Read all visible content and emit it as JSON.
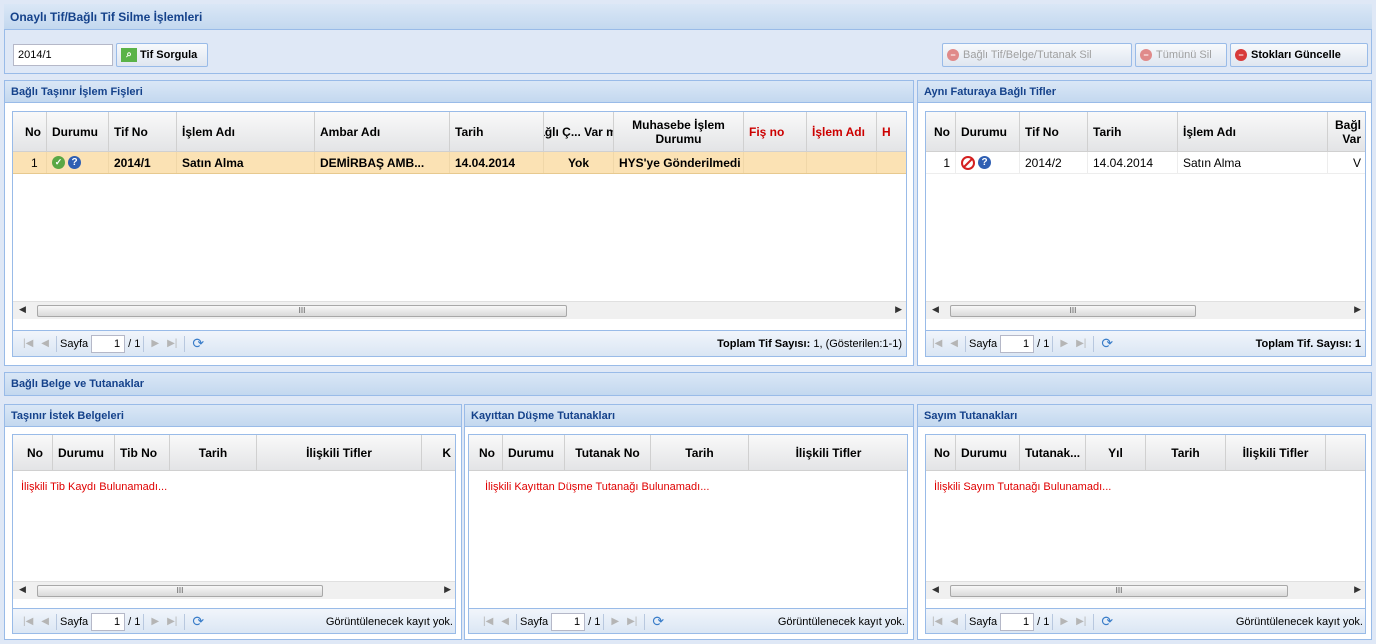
{
  "window_title": "Onaylı Tif/Bağlı Tif Silme İşlemleri",
  "toolbar": {
    "tif_input_value": "2014/1",
    "query_button": "Tif Sorgula",
    "delete_linked_button": "Bağlı Tif/Belge/Tutanak Sil",
    "delete_all_button": "Tümünü Sil",
    "update_stock_button": "Stokları Güncelle"
  },
  "fisler": {
    "title": "Bağlı Taşınır İşlem Fişleri",
    "columns": [
      "No",
      "Durumu",
      "Tif No",
      "İşlem Adı",
      "Ambar Adı",
      "Tarih",
      "Bağlı Ç... Var mı?",
      "Muhasebe İşlem Durumu",
      "Fiş no",
      "İşlem Adı",
      "H"
    ],
    "rows": [
      {
        "no": "1",
        "tif_no": "2014/1",
        "islem_adi": "Satın Alma",
        "ambar_adi": "DEMİRBAŞ AMB...",
        "tarih": "14.04.2014",
        "bagli": "Yok",
        "muhasebe": "HYS'ye Gönderilmedi"
      }
    ],
    "pager": {
      "page_label": "Sayfa",
      "page_value": "1",
      "page_total": "/ 1",
      "summary_label": "Toplam Tif Sayısı:",
      "summary_value": "1, (Gösterilen:1-1)"
    }
  },
  "ayni_fatura": {
    "title": "Aynı Faturaya Bağlı Tifler",
    "columns": [
      "No",
      "Durumu",
      "Tif No",
      "Tarih",
      "İşlem Adı",
      "Bağl Var"
    ],
    "rows": [
      {
        "no": "1",
        "tif_no": "2014/2",
        "tarih": "14.04.2014",
        "islem_adi": "Satın Alma",
        "bagli": "V"
      }
    ],
    "pager": {
      "page_label": "Sayfa",
      "page_value": "1",
      "page_total": "/ 1",
      "summary": "Toplam Tif. Sayısı: 1"
    }
  },
  "belgeler_title": "Bağlı Belge ve Tutanaklar",
  "istek": {
    "title": "Taşınır İstek Belgeleri",
    "columns": [
      "No",
      "Durumu",
      "Tib No",
      "Tarih",
      "İlişkili Tifler",
      "K"
    ],
    "empty": "İlişkili Tib Kaydı Bulunamadı...",
    "pager": {
      "page_label": "Sayfa",
      "page_value": "1",
      "page_total": "/ 1",
      "summary": "Görüntülenecek kayıt yok."
    }
  },
  "kayittan": {
    "title": "Kayıttan Düşme Tutanakları",
    "columns": [
      "No",
      "Durumu",
      "Tutanak No",
      "Tarih",
      "İlişkili Tifler"
    ],
    "empty": "İlişkili Kayıttan Düşme Tutanağı Bulunamadı...",
    "pager": {
      "page_label": "Sayfa",
      "page_value": "1",
      "page_total": "/ 1",
      "summary": "Görüntülenecek kayıt yok."
    }
  },
  "sayim": {
    "title": "Sayım Tutanakları",
    "columns": [
      "No",
      "Durumu",
      "Tutanak...",
      "Yıl",
      "Tarih",
      "İlişkili Tifler"
    ],
    "empty": "İlişkili Sayım Tutanağı Bulunamadı...",
    "pager": {
      "page_label": "Sayfa",
      "page_value": "1",
      "page_total": "/ 1",
      "summary": "Görüntülenecek kayıt yok."
    }
  },
  "scroll_thumb_label": "III"
}
